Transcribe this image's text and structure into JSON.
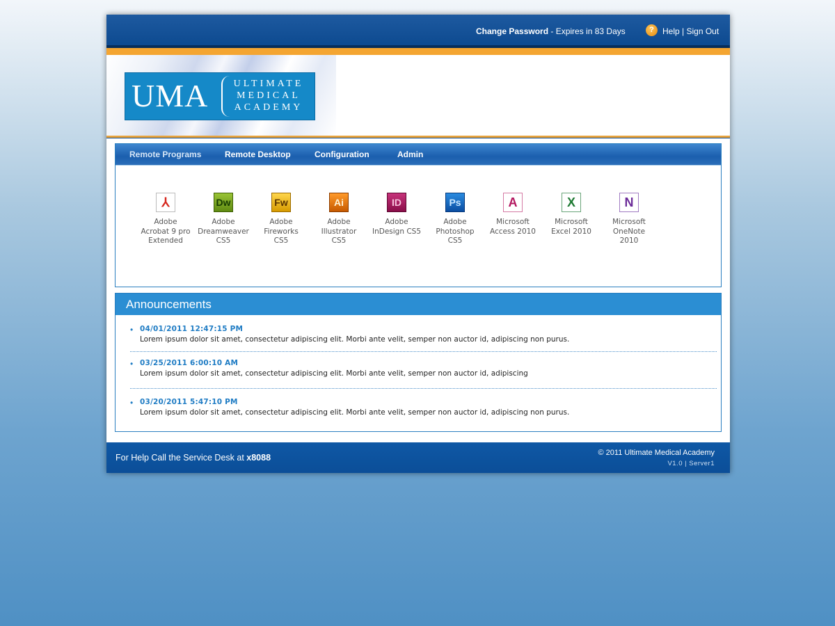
{
  "topbar": {
    "change_password": "Change Password",
    "expires": " - Expires in 83 Days",
    "help_icon": "help-icon",
    "help": "Help",
    "separator": " | ",
    "sign_out": "Sign Out"
  },
  "logo": {
    "mark": "UMA",
    "line1": "ULTIMATE",
    "line2": "MEDICAL",
    "line3": "ACADEMY"
  },
  "nav": {
    "tabs": [
      "Remote Programs",
      "Remote Desktop",
      "Configuration",
      "Admin"
    ],
    "active": "Remote Programs"
  },
  "apps": [
    {
      "icon": "acrobat-icon",
      "glyph": "⅄",
      "label": "Adobe\nAcrobat 9 pro\nExtended"
    },
    {
      "icon": "dreamweaver-icon",
      "glyph": "Dw",
      "label": "Adobe\nDreamweaver\nCS5"
    },
    {
      "icon": "fireworks-icon",
      "glyph": "Fw",
      "label": "Adobe\nFireworks\nCS5"
    },
    {
      "icon": "illustrator-icon",
      "glyph": "Ai",
      "label": "Adobe\nIllustrator\nCS5"
    },
    {
      "icon": "indesign-icon",
      "glyph": "ID",
      "label": "Adobe\nInDesign CS5"
    },
    {
      "icon": "photoshop-icon",
      "glyph": "Ps",
      "label": "Adobe\nPhotoshop\nCS5"
    },
    {
      "icon": "access-icon",
      "glyph": "A",
      "label": "Microsoft\nAccess 2010"
    },
    {
      "icon": "excel-icon",
      "glyph": "X",
      "label": "Microsoft\nExcel 2010"
    },
    {
      "icon": "onenote-icon",
      "glyph": "N",
      "label": "Microsoft\nOneNote\n2010"
    }
  ],
  "announcements": {
    "title": "Announcements",
    "items": [
      {
        "date": "04/01/2011 12:47:15 PM",
        "text": "Lorem ipsum dolor sit amet, consectetur adipiscing elit. Morbi ante velit, semper non auctor id, adipiscing non purus."
      },
      {
        "date": "03/25/2011 6:00:10 AM",
        "text": "Lorem ipsum dolor sit amet, consectetur adipiscing elit. Morbi ante velit, semper non auctor id, adipiscing"
      },
      {
        "date": "03/20/2011 5:47:10 PM",
        "text": "Lorem ipsum dolor sit amet, consectetur adipiscing elit. Morbi ante velit, semper non auctor id, adipiscing non purus."
      }
    ]
  },
  "footer": {
    "help_prefix": "For Help Call the Service Desk at ",
    "ext": "x8088",
    "copyright": "© 2011 Ultimate Medical Academy",
    "version": "V1.0 | Server1"
  },
  "colors": {
    "topbar": "#0d4a90",
    "accent_orange": "#f4a531",
    "link_blue": "#1f7cc4",
    "announcement_header": "#2b8ed3"
  }
}
